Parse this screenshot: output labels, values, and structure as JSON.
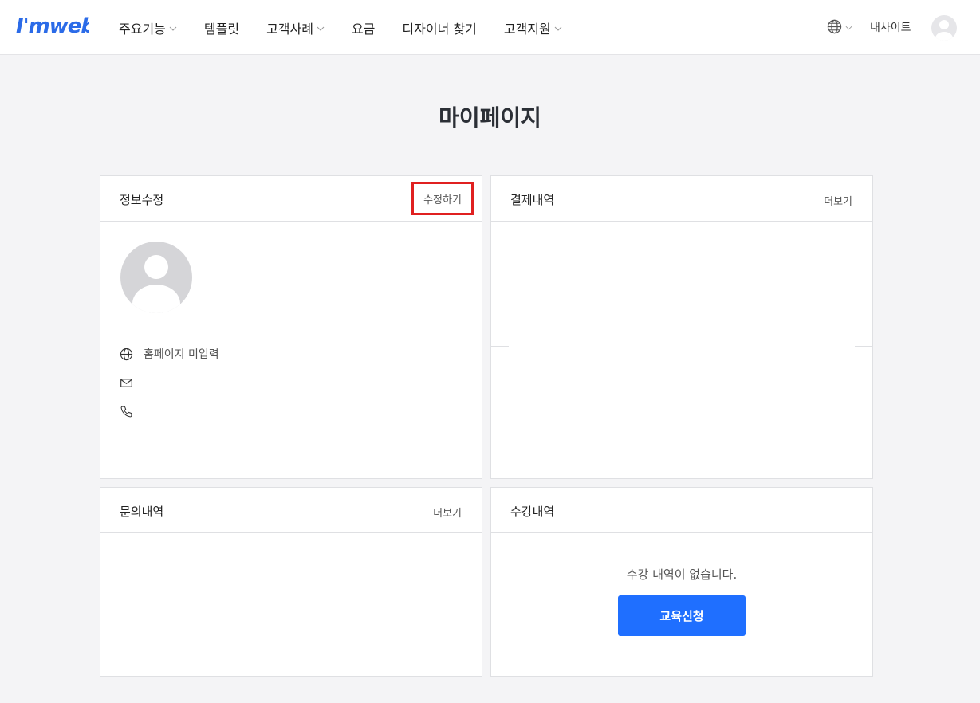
{
  "header": {
    "logo_text": "i'mweb",
    "nav": [
      {
        "label": "주요기능",
        "has_dropdown": true
      },
      {
        "label": "템플릿",
        "has_dropdown": false
      },
      {
        "label": "고객사례",
        "has_dropdown": true
      },
      {
        "label": "요금",
        "has_dropdown": false
      },
      {
        "label": "디자이너 찾기",
        "has_dropdown": false
      },
      {
        "label": "고객지원",
        "has_dropdown": true
      }
    ],
    "language_icon": "globe-icon",
    "mysite_label": "내사이트",
    "avatar_icon": "user-avatar-icon"
  },
  "page": {
    "title": "마이페이지"
  },
  "profile_card": {
    "title": "정보수정",
    "edit_label": "수정하기",
    "homepage_text": "홈페이지 미입력",
    "email_text": "",
    "phone_text": ""
  },
  "payment_card": {
    "title": "결제내역",
    "more_label": "더보기"
  },
  "inquiry_card": {
    "title": "문의내역",
    "more_label": "더보기"
  },
  "course_card": {
    "title": "수강내역",
    "empty_message": "수강 내역이 없습니다.",
    "apply_label": "교육신청"
  },
  "colors": {
    "accent": "#1f6fff",
    "highlight": "#e02020",
    "background": "#f4f4f6",
    "logo": "#2b6be8"
  }
}
